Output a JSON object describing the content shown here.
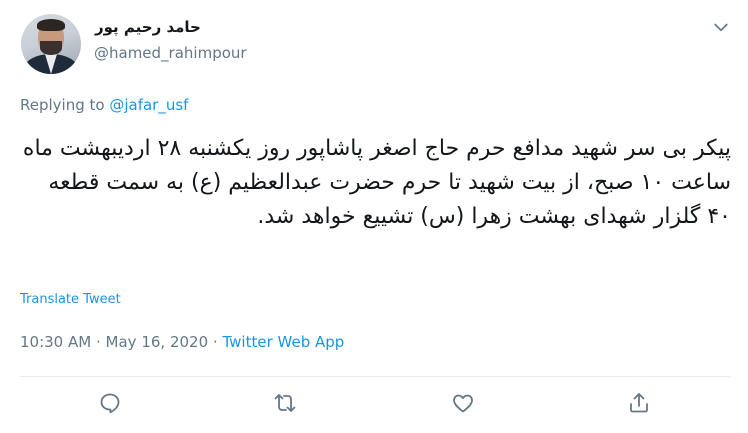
{
  "user": {
    "name": "حامد رحیم پور",
    "handle": "@hamed_rahimpour"
  },
  "reply": {
    "prefix": "Replying to ",
    "to": "@jafar_usf"
  },
  "tweet": {
    "text": "پیکر بی سر شهید مدافع حرم حاج اصغر پاشاپور روز یکشنبه ۲۸ اردیبهشت ماه ساعت ۱۰ صبح، از بیت شهید تا حرم حضرت عبدالعظیم (ع) به سمت قطعه ۴۰ گلزار شهدای بهشت زهرا (س) تشییع خواهد شد.",
    "translate_label": "Translate Tweet",
    "time": "10:30 AM",
    "separator": "·",
    "date": "May 16, 2020",
    "source": "Twitter Web App"
  },
  "actions": [
    {
      "icon": "reply-icon"
    },
    {
      "icon": "retweet-icon"
    },
    {
      "icon": "like-icon"
    },
    {
      "icon": "share-icon"
    }
  ],
  "colors": {
    "accent": "#1b95e0",
    "secondary_text": "#657786",
    "primary_text": "#14171a",
    "divider": "#e6ecf0"
  }
}
